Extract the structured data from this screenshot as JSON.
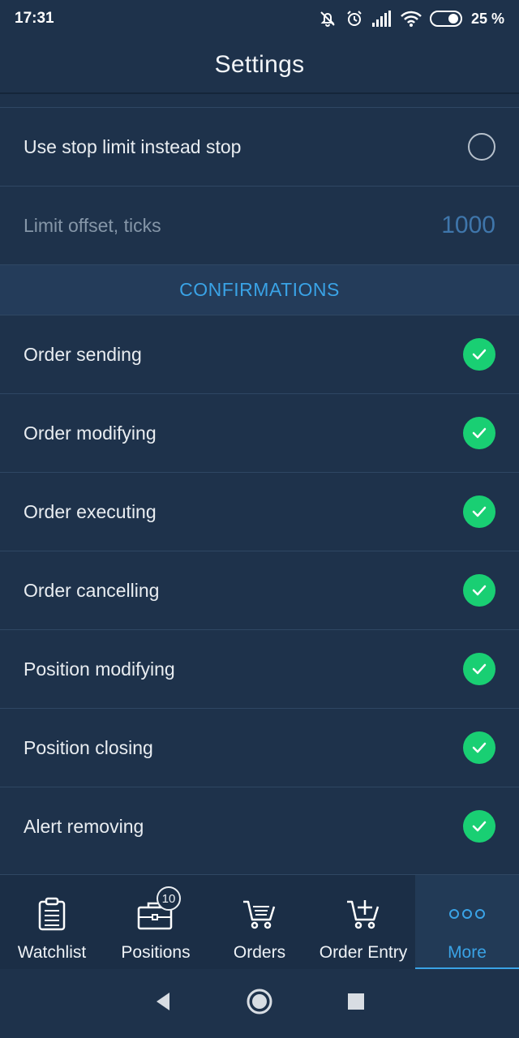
{
  "status": {
    "time": "17:31",
    "battery": "25 %"
  },
  "appbar": {
    "title": "Settings"
  },
  "rows_top": [
    {
      "label": "Use stop limit instead stop",
      "control": "radio",
      "checked": false
    },
    {
      "label": "Limit offset, ticks",
      "value": "1000"
    }
  ],
  "section": {
    "label": "CONFIRMATIONS"
  },
  "confirmations": [
    {
      "label": "Order sending",
      "checked": true
    },
    {
      "label": "Order modifying",
      "checked": true
    },
    {
      "label": "Order executing",
      "checked": true
    },
    {
      "label": "Order cancelling",
      "checked": true
    },
    {
      "label": "Position modifying",
      "checked": true
    },
    {
      "label": "Position closing",
      "checked": true
    },
    {
      "label": "Alert removing",
      "checked": true
    }
  ],
  "tabs": [
    {
      "label": "Watchlist",
      "icon": "clipboard-icon"
    },
    {
      "label": "Positions",
      "icon": "briefcase-icon",
      "badge": "10"
    },
    {
      "label": "Orders",
      "icon": "cart-list-icon"
    },
    {
      "label": "Order Entry",
      "icon": "cart-plus-icon"
    },
    {
      "label": "More",
      "icon": "more-dots-icon",
      "active": true
    }
  ],
  "colors": {
    "background": "#1e324b",
    "accent": "#3aa3e6",
    "check": "#19cf73"
  }
}
